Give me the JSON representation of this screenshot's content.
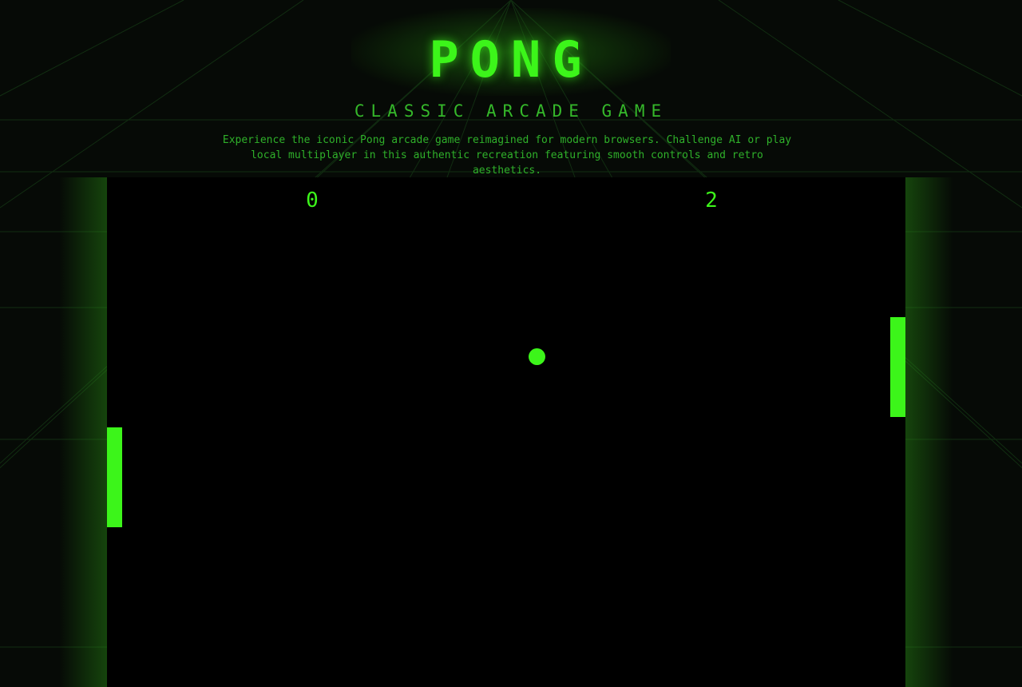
{
  "header": {
    "title": "PONG",
    "subtitle": "CLASSIC ARCADE GAME",
    "description": "Experience the iconic Pong arcade game reimagined for modern browsers. Challenge AI or play local multiplayer in this authentic recreation featuring smooth controls and retro aesthetics."
  },
  "game": {
    "score_left": "0",
    "score_right": "2"
  },
  "colors": {
    "accent": "#3cf51a",
    "background": "#060a06",
    "board": "#000000"
  }
}
